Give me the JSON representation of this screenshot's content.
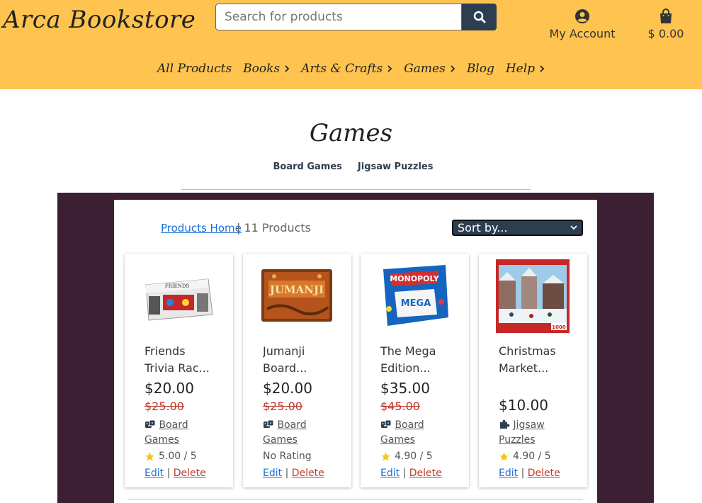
{
  "header": {
    "logo": "Arca Bookstore",
    "search_placeholder": "Search for products",
    "account_label": "My Account",
    "cart_label": "$ 0.00"
  },
  "nav": [
    {
      "label": "All Products",
      "has_chevron": false
    },
    {
      "label": "Books",
      "has_chevron": true
    },
    {
      "label": "Arts & Crafts",
      "has_chevron": true
    },
    {
      "label": "Games",
      "has_chevron": true
    },
    {
      "label": "Blog",
      "has_chevron": false
    },
    {
      "label": "Help",
      "has_chevron": true
    }
  ],
  "page": {
    "title": "Games",
    "subcategories": [
      "Board Games",
      "Jigsaw Puzzles"
    ]
  },
  "listing": {
    "products_home": "Products Home",
    "separator": "|",
    "count": "11 Products",
    "sort_label": "Sort by..."
  },
  "products": [
    {
      "name_line1": "Friends",
      "name_line2": "Trivia Rac...",
      "price": "$20.00",
      "old_price": "$25.00",
      "category_line1": "Board",
      "category_line2": "Games",
      "category_icon": "dice-icon",
      "rating": "5.00 / 5",
      "has_star": true,
      "edit": "Edit",
      "delete": "Delete"
    },
    {
      "name_line1": "Jumanji",
      "name_line2": "Board...",
      "price": "$20.00",
      "old_price": "$25.00",
      "category_line1": "Board",
      "category_line2": "Games",
      "category_icon": "dice-icon",
      "rating": "No Rating",
      "has_star": false,
      "edit": "Edit",
      "delete": "Delete"
    },
    {
      "name_line1": "The Mega",
      "name_line2": "Edition...",
      "price": "$35.00",
      "old_price": "$45.00",
      "category_line1": "Board",
      "category_line2": "Games",
      "category_icon": "dice-icon",
      "rating": "4.90 / 5",
      "has_star": true,
      "edit": "Edit",
      "delete": "Delete"
    },
    {
      "name_line1": "Christmas",
      "name_line2": "Market...",
      "price": "$10.00",
      "old_price": "",
      "category_line1": "Jigsaw",
      "category_line2": "Puzzles",
      "category_icon": "puzzle-icon",
      "rating": "4.90 / 5",
      "has_star": true,
      "edit": "Edit",
      "delete": "Delete"
    }
  ],
  "images": [
    {
      "product_text": "FRIENDS"
    },
    {
      "product_text": "JUMANJI"
    },
    {
      "product_text": "MONOPOLY",
      "sub_text": "MEGA"
    },
    {
      "product_text": "1000"
    }
  ],
  "colors": {
    "header_bg": "#fec44f",
    "dark_band": "#3d1f33",
    "primary": "#2c3e50",
    "link": "#1a6fd6",
    "danger": "#c0392b",
    "star": "#f5c518"
  }
}
